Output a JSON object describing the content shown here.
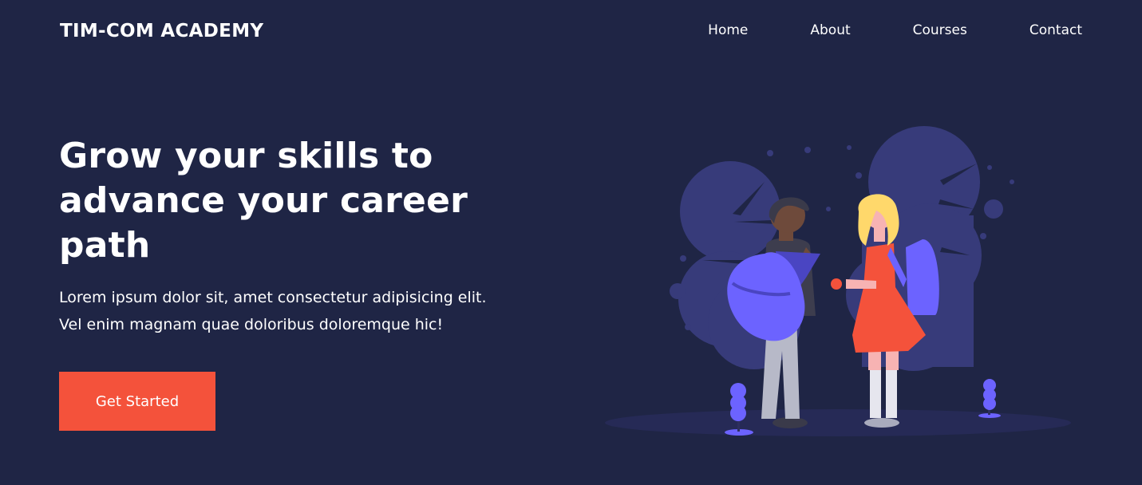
{
  "header": {
    "brand": "TIM-COM ACADEMY",
    "nav": [
      {
        "label": "Home"
      },
      {
        "label": "About"
      },
      {
        "label": "Courses"
      },
      {
        "label": "Contact"
      }
    ]
  },
  "hero": {
    "headline": "Grow your skills to advance your career path",
    "description_line1": "Lorem ipsum dolor sit, amet consectetur adipisicing elit.",
    "description_line2": "Vel enim magnam quae doloribus doloremque hic!",
    "cta_label": "Get Started"
  },
  "colors": {
    "background": "#1f2545",
    "accent": "#f4523b",
    "illustration_blob": "#373b7a",
    "backpack": "#6c63ff"
  },
  "illustration": {
    "icon": "students-with-backpacks-illustration"
  }
}
